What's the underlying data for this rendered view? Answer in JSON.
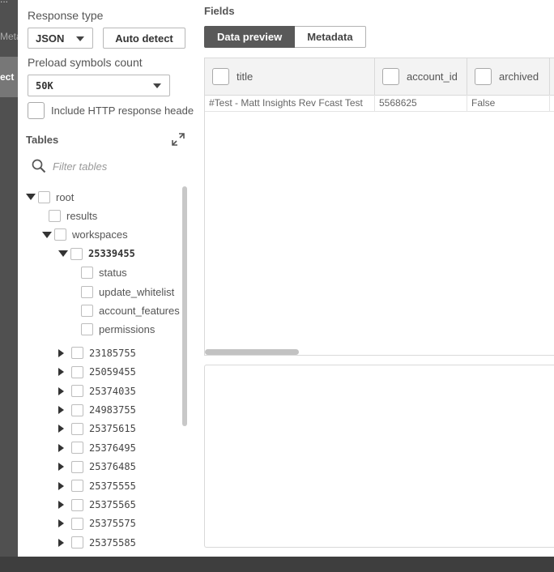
{
  "background_strip": {
    "labels": [
      "...",
      "Meta",
      "ect"
    ]
  },
  "response_type": {
    "label": "Response type",
    "value": "JSON",
    "auto_detect": "Auto detect"
  },
  "preload": {
    "label": "Preload symbols count",
    "value": "50K"
  },
  "include_http": {
    "label": "Include HTTP response heade"
  },
  "tables": {
    "title": "Tables",
    "filter_placeholder": "Filter tables",
    "tree": [
      {
        "label": "root",
        "level": 0,
        "toggle": "expanded"
      },
      {
        "label": "results",
        "level": 1,
        "toggle": "none"
      },
      {
        "label": "workspaces",
        "level": 1,
        "toggle": "expanded"
      },
      {
        "label": "25339455",
        "level": 2,
        "toggle": "expanded",
        "bold": true
      },
      {
        "label": "status",
        "level": 3,
        "toggle": "none"
      },
      {
        "label": "update_whitelist",
        "level": 3,
        "toggle": "none"
      },
      {
        "label": "account_features",
        "level": 3,
        "toggle": "none"
      },
      {
        "label": "permissions",
        "level": 3,
        "toggle": "none"
      },
      {
        "label": "23185755",
        "level": 2,
        "toggle": "collapsed"
      },
      {
        "label": "25059455",
        "level": 2,
        "toggle": "collapsed"
      },
      {
        "label": "25374035",
        "level": 2,
        "toggle": "collapsed"
      },
      {
        "label": "24983755",
        "level": 2,
        "toggle": "collapsed"
      },
      {
        "label": "25375615",
        "level": 2,
        "toggle": "collapsed"
      },
      {
        "label": "25376495",
        "level": 2,
        "toggle": "collapsed"
      },
      {
        "label": "25376485",
        "level": 2,
        "toggle": "collapsed"
      },
      {
        "label": "25375555",
        "level": 2,
        "toggle": "collapsed"
      },
      {
        "label": "25375565",
        "level": 2,
        "toggle": "collapsed"
      },
      {
        "label": "25375575",
        "level": 2,
        "toggle": "collapsed"
      },
      {
        "label": "25375585",
        "level": 2,
        "toggle": "collapsed"
      }
    ]
  },
  "fields": {
    "title": "Fields",
    "tabs": [
      {
        "label": "Data preview",
        "active": true
      },
      {
        "label": "Metadata",
        "active": false
      }
    ],
    "columns": [
      "title",
      "account_id",
      "archived"
    ],
    "rows": [
      [
        "#Test - Matt Insights Rev Fcast Test",
        "5568625",
        "False"
      ]
    ]
  }
}
